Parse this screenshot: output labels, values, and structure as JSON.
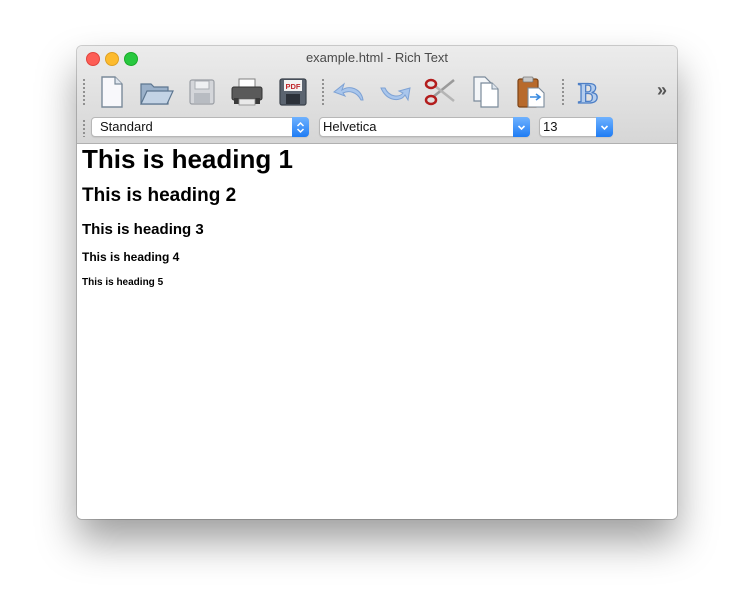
{
  "window": {
    "title": "example.html - Rich Text"
  },
  "toolbar": {
    "buttons": [
      {
        "name": "new-document",
        "icon": "new-document-icon"
      },
      {
        "name": "open",
        "icon": "folder-icon"
      },
      {
        "name": "save",
        "icon": "floppy-disk-icon"
      },
      {
        "name": "print",
        "icon": "printer-icon"
      },
      {
        "name": "save-pdf",
        "icon": "pdf-floppy-icon"
      },
      {
        "name": "undo",
        "icon": "undo-arrow-icon"
      },
      {
        "name": "redo",
        "icon": "redo-arrow-icon"
      },
      {
        "name": "cut",
        "icon": "scissors-icon"
      },
      {
        "name": "copy",
        "icon": "copy-icon"
      },
      {
        "name": "paste",
        "icon": "clipboard-icon"
      },
      {
        "name": "bold",
        "icon": "bold-b-icon"
      }
    ],
    "overflow_label": "»",
    "pdf_label": "PDF",
    "bold_label": "B"
  },
  "formatbar": {
    "paragraph_style": "Standard",
    "font_family": "Helvetica",
    "font_size": "13"
  },
  "document": {
    "headings": [
      "This is heading 1",
      "This is heading 2",
      "This is heading 3",
      "This is heading 4",
      "This is heading 5"
    ]
  },
  "colors": {
    "accent": "#2f86f6",
    "close": "#fd5e56",
    "minimize": "#fdbb2e",
    "maximize": "#28c83f"
  }
}
